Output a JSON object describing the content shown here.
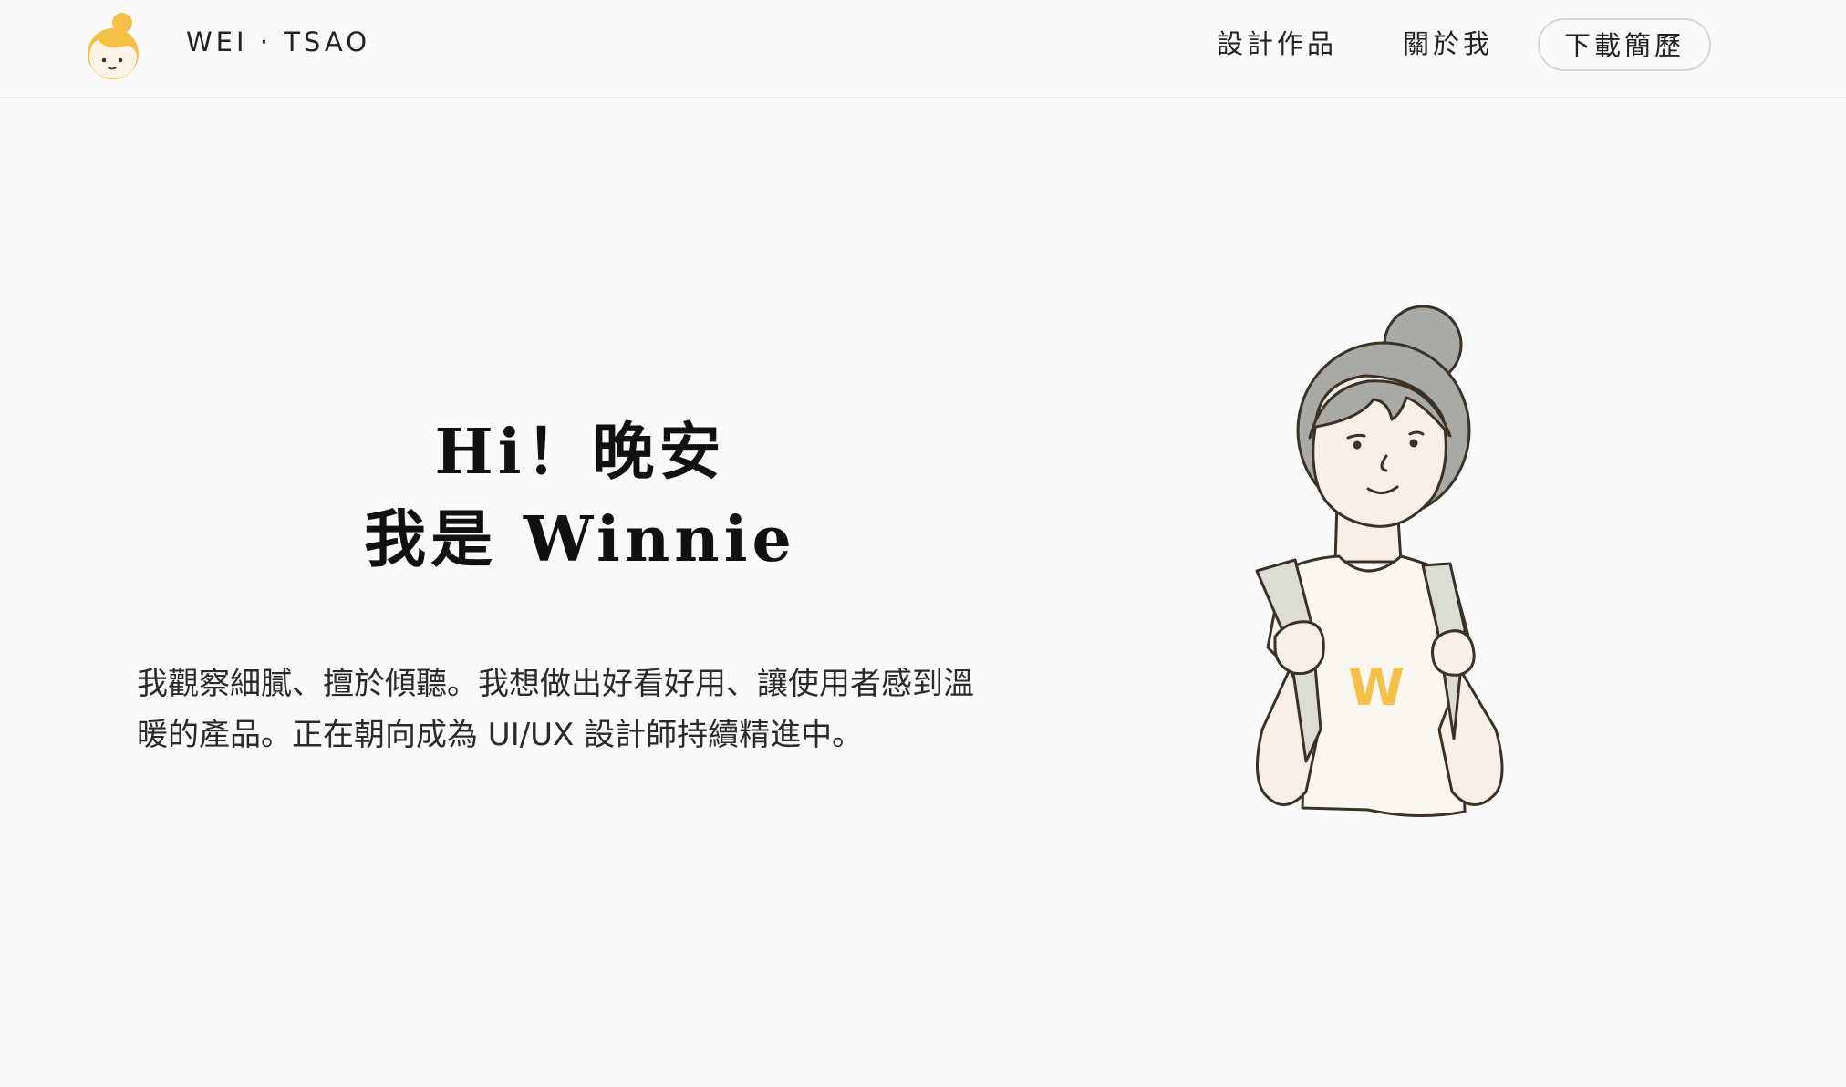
{
  "header": {
    "brand": "WEI · TSAO",
    "nav": {
      "works": "設計作品",
      "about": "關於我",
      "resume": "下載簡歷"
    }
  },
  "hero": {
    "greeting": "Hi！晚安",
    "intro": "我是 Winnie",
    "description_line1": "我觀察細膩、擅於傾聽。我想做出好看好用、讓使用者感到溫",
    "description_line2": "暖的產品。正在朝向成為 UI/UX 設計師持續精進中。"
  },
  "illustration": {
    "shirt_letter": "W"
  },
  "colors": {
    "accent_yellow": "#f5c048",
    "hair_gray": "#a9a9a5",
    "skin": "#f8efe9",
    "background": "#fafafa",
    "outline": "#3a3226"
  },
  "icons": {
    "logo": "girl-face-logo-icon"
  }
}
